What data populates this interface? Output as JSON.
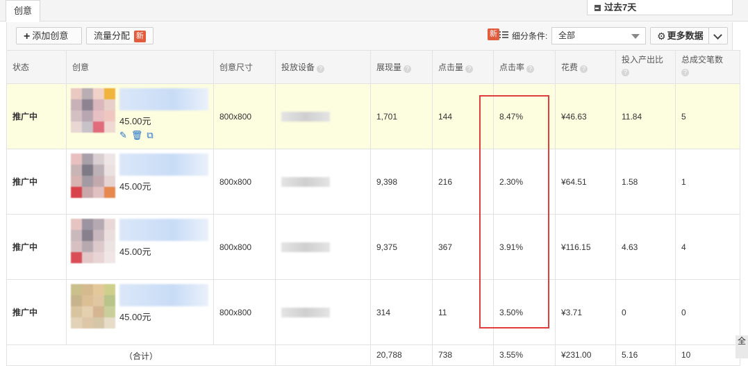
{
  "tabs": [
    {
      "label": "创意"
    }
  ],
  "date_range": {
    "label": "过去7天",
    "icon": "calendar-icon"
  },
  "toolbar": {
    "add_label": "添加创意",
    "flow_label": "流量分配",
    "new_badge": "新",
    "filter_label": "细分条件:",
    "filter_value": "全部",
    "more_label": "更多数据"
  },
  "columns": [
    {
      "label": "状态",
      "help": false
    },
    {
      "label": "创意",
      "help": false
    },
    {
      "label": "创意尺寸",
      "help": false
    },
    {
      "label": "投放设备",
      "help": true
    },
    {
      "label": "展现量",
      "help": true
    },
    {
      "label": "点击量",
      "help": true
    },
    {
      "label": "点击率",
      "help": true
    },
    {
      "label": "花费",
      "help": true
    },
    {
      "label": "投入产出比",
      "help": true
    },
    {
      "label": "总成交笔数",
      "help": true
    }
  ],
  "rows": [
    {
      "status": "推广中",
      "price": "45.00元",
      "size": "800x800",
      "impressions": "1,701",
      "clicks": "144",
      "ctr": "8.47%",
      "cost": "¥46.63",
      "roi": "11.84",
      "orders": "5"
    },
    {
      "status": "推广中",
      "price": "45.00元",
      "size": "800x800",
      "impressions": "9,398",
      "clicks": "216",
      "ctr": "2.30%",
      "cost": "¥64.51",
      "roi": "1.58",
      "orders": "1"
    },
    {
      "status": "推广中",
      "price": "45.00元",
      "size": "800x800",
      "impressions": "9,375",
      "clicks": "367",
      "ctr": "3.91%",
      "cost": "¥116.15",
      "roi": "4.63",
      "orders": "4"
    },
    {
      "status": "推广中",
      "price": "45.00元",
      "size": "800x800",
      "impressions": "314",
      "clicks": "11",
      "ctr": "3.50%",
      "cost": "¥3.71",
      "roi": "0",
      "orders": "0"
    }
  ],
  "total": {
    "label": "（合计）",
    "impressions": "20,788",
    "clicks": "738",
    "ctr": "3.55%",
    "cost": "¥231.00",
    "roi": "5.16",
    "orders": "10"
  },
  "side_tab": {
    "label": "全"
  },
  "colors": {
    "status_green": "#2a9a2a",
    "highlight_row": "#fdfde0",
    "annotation_red": "#e03c3c",
    "badge_red": "#e25b3c",
    "link_blue": "#3a78c8"
  }
}
